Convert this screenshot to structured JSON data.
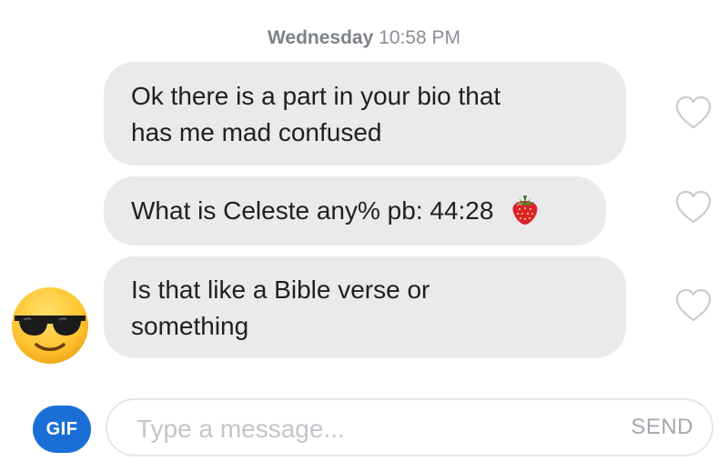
{
  "timestamp": {
    "day": "Wednesday",
    "time": "10:58 PM"
  },
  "messages": [
    {
      "lines": [
        "Ok there is a part in your bio that",
        "has me mad confused"
      ],
      "liked": false
    },
    {
      "lines": [
        "What is Celeste any% pb: 44:28"
      ],
      "emoji": "strawberry-icon",
      "liked": false
    },
    {
      "lines": [
        "Is that like a Bible verse or",
        "something"
      ],
      "liked": false
    }
  ],
  "sender_avatar": "sunglasses-emoji-icon",
  "composer": {
    "gif_label": "GIF",
    "placeholder": "Type a message...",
    "send_label": "SEND"
  },
  "colors": {
    "bubble": "#eaeaec",
    "gif_button": "#1a6fd6",
    "heart_outline": "#c9cbd0"
  }
}
